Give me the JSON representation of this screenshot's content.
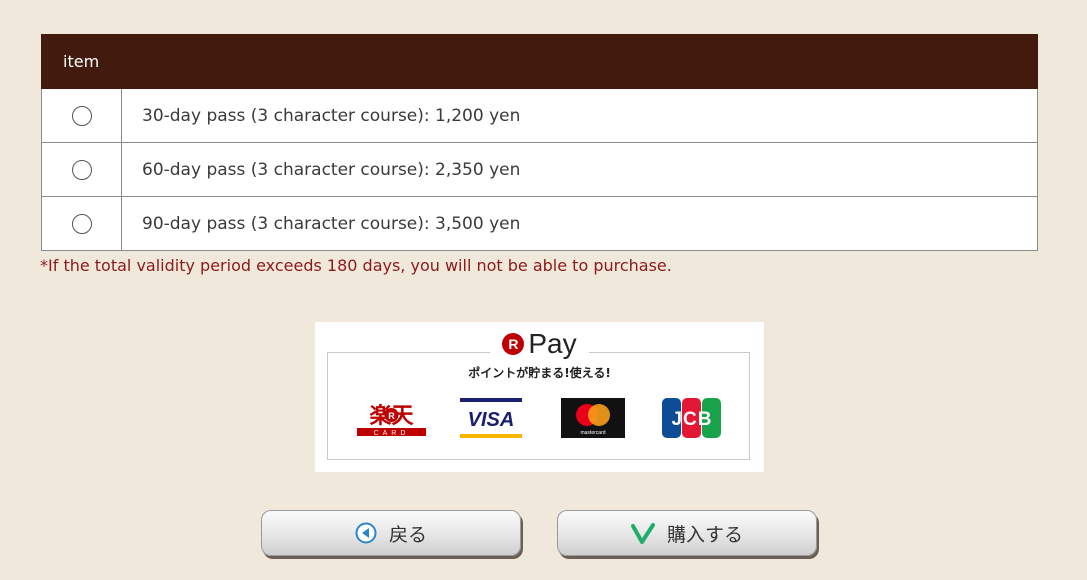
{
  "table": {
    "header": "item",
    "rows": [
      {
        "label": "30-day pass (3 character course): 1,200 yen"
      },
      {
        "label": "60-day pass (3 character course): 2,350 yen"
      },
      {
        "label": "90-day pass (3 character course): 3,500 yen"
      }
    ]
  },
  "note": "*If the total validity period exceeds 180 days, you will not be able to purchase.",
  "payment_banner": {
    "logo_r": "R",
    "logo_word": "Pay",
    "tagline": "ポイントが貯まる!使える!",
    "cards": [
      {
        "icon": "rakuten-card-logo",
        "text": "楽天",
        "sub": "CARD"
      },
      {
        "icon": "visa-logo",
        "text": "VISA"
      },
      {
        "icon": "mastercard-logo",
        "text": "mastercard"
      },
      {
        "icon": "jcb-logo",
        "text": "JCB"
      }
    ]
  },
  "buttons": {
    "back_label": "戻る",
    "buy_label": "購入する"
  },
  "colors": {
    "background": "#f1e8dc",
    "header_bg": "#421a0e",
    "note_text": "#8b1a1a",
    "rakuten_red": "#bf0000"
  }
}
